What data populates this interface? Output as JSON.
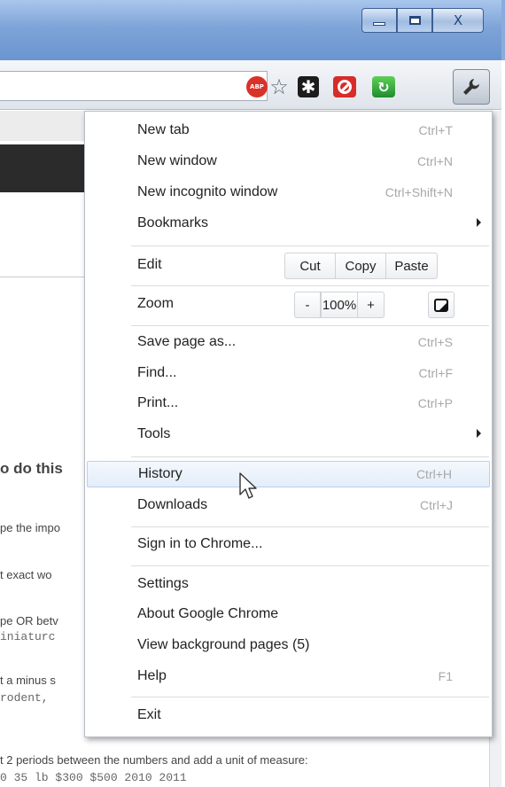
{
  "window": {
    "minimize_icon": "minimize-icon",
    "maximize_icon": "maximize-icon",
    "close_label": "X"
  },
  "toolbar": {
    "adblock_label": "ABP",
    "asterisk_label": "✱",
    "green_ext_label": "↻",
    "wrench_icon": "wrench-icon"
  },
  "page": {
    "heading_fragment": "o do this",
    "lines": [
      "pe the impo",
      "t exact wo",
      "pe OR betv",
      "iniaturc",
      "t a minus s",
      "rodent,",
      "t 2 periods between the numbers and add a unit of measure:",
      "0   35 lb  $300  $500  2010  2011"
    ]
  },
  "menu": {
    "new_tab": {
      "label": "New tab",
      "shortcut": "Ctrl+T"
    },
    "new_window": {
      "label": "New window",
      "shortcut": "Ctrl+N"
    },
    "new_incognito": {
      "label": "New incognito window",
      "shortcut": "Ctrl+Shift+N"
    },
    "bookmarks": {
      "label": "Bookmarks"
    },
    "edit": {
      "label": "Edit",
      "cut": "Cut",
      "copy": "Copy",
      "paste": "Paste"
    },
    "zoom": {
      "label": "Zoom",
      "minus": "-",
      "value": "100%",
      "plus": "+"
    },
    "save_page": {
      "label": "Save page as...",
      "shortcut": "Ctrl+S"
    },
    "find": {
      "label": "Find...",
      "shortcut": "Ctrl+F"
    },
    "print": {
      "label": "Print...",
      "shortcut": "Ctrl+P"
    },
    "tools": {
      "label": "Tools"
    },
    "history": {
      "label": "History",
      "shortcut": "Ctrl+H"
    },
    "downloads": {
      "label": "Downloads",
      "shortcut": "Ctrl+J"
    },
    "sign_in": {
      "label": "Sign in to Chrome..."
    },
    "settings": {
      "label": "Settings"
    },
    "about": {
      "label": "About Google Chrome"
    },
    "background_pages": {
      "label": "View background pages (5)"
    },
    "help": {
      "label": "Help",
      "shortcut": "F1"
    },
    "exit": {
      "label": "Exit"
    }
  },
  "colors": {
    "title_bar": "#7ea4d8",
    "hover_highlight": "#e3edf9",
    "shortcut_text": "#a8a8a8"
  }
}
